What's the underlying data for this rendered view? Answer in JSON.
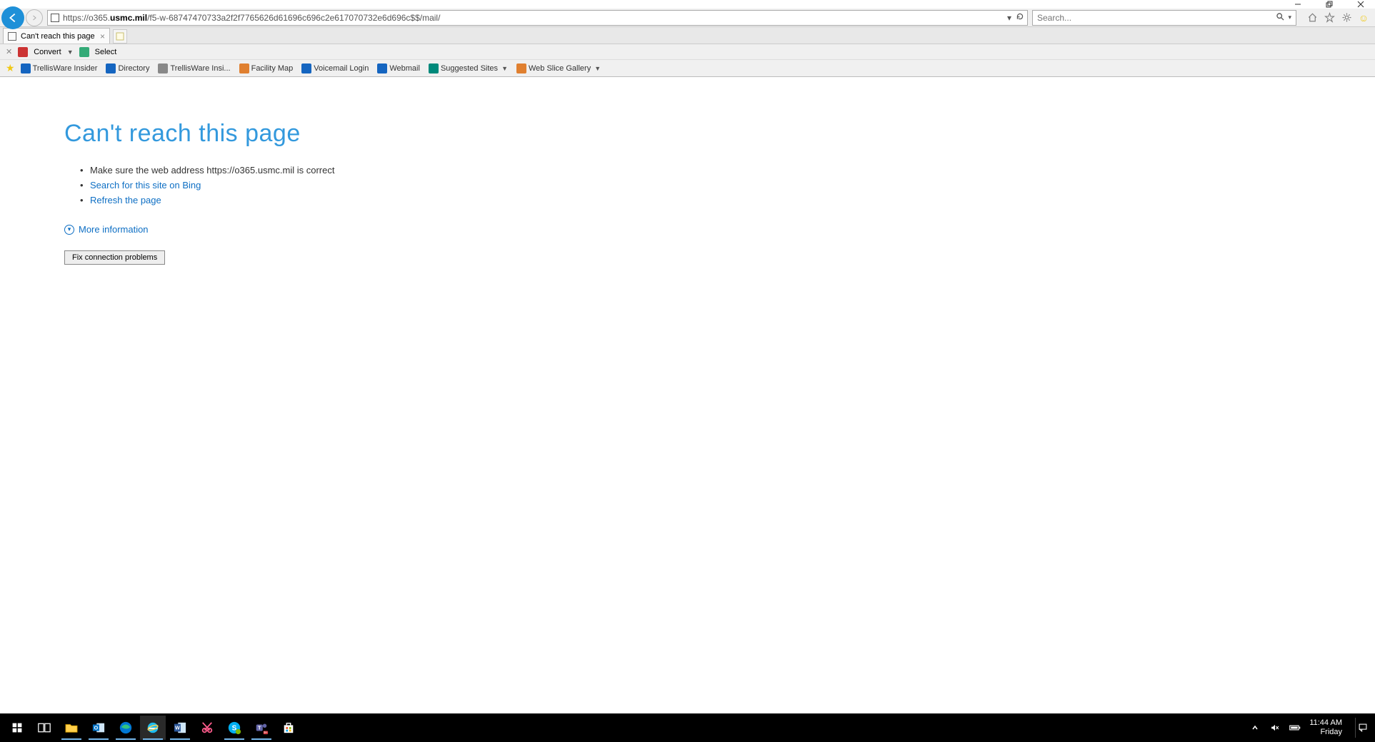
{
  "window": {
    "minimize": "minimize",
    "maximize": "restore",
    "close": "close"
  },
  "nav": {
    "url_prefix": "https://o365.",
    "url_domain": "usmc.mil",
    "url_suffix": "/f5-w-68747470733a2f2f7765626d61696c696c2e617070732e6d696c$$/mail/",
    "search_placeholder": "Search..."
  },
  "tab": {
    "title": "Can't reach this page"
  },
  "convertbar": {
    "convert": "Convert",
    "select": "Select"
  },
  "favorites": [
    {
      "label": "TrellisWare Insider",
      "color": "#1565c0"
    },
    {
      "label": "Directory",
      "color": "#1565c0"
    },
    {
      "label": "TrellisWare Insi...",
      "color": "#888"
    },
    {
      "label": "Facility Map",
      "color": "#e08030"
    },
    {
      "label": "Voicemail Login",
      "color": "#1565c0"
    },
    {
      "label": "Webmail",
      "color": "#1565c0"
    },
    {
      "label": "Suggested Sites",
      "color": "#00897b",
      "dropdown": true
    },
    {
      "label": "Web Slice Gallery",
      "color": "#e08030",
      "dropdown": true
    }
  ],
  "error": {
    "title": "Can't reach this page",
    "line1": "Make sure the web address https://o365.usmc.mil is correct",
    "line2": "Search for this site on Bing",
    "line3": "Refresh the page",
    "more": "More information",
    "fix_button": "Fix connection problems"
  },
  "taskbar": {
    "apps": [
      {
        "name": "start-button",
        "color": "#fff"
      },
      {
        "name": "task-view",
        "color": "#fff"
      },
      {
        "name": "file-explorer",
        "color": "#ffcf4b",
        "running": true
      },
      {
        "name": "outlook",
        "color": "#0072c6",
        "running": true
      },
      {
        "name": "edge",
        "color": "#0078d4",
        "running": true
      },
      {
        "name": "internet-explorer",
        "color": "#1ebbee",
        "running": true,
        "active": true
      },
      {
        "name": "word",
        "color": "#2b579a",
        "running": true
      },
      {
        "name": "snip",
        "color": "#ff5c8d"
      },
      {
        "name": "skype",
        "color": "#00aff0",
        "running": true
      },
      {
        "name": "teams",
        "color": "#6264a7",
        "running": true
      },
      {
        "name": "store",
        "color": "#fff"
      }
    ],
    "time": "11:44 AM",
    "day": "Friday"
  }
}
